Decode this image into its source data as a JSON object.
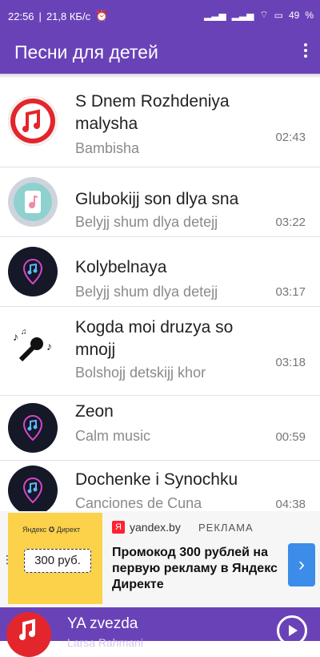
{
  "status": {
    "time": "22:56",
    "speed": "21,8 КБ/с",
    "battery": "49"
  },
  "appbar": {
    "title": "Песни для детей",
    "menu_icon": "more-vert-icon"
  },
  "songs": [
    {
      "title": "S Dnem Rozhdeniya malysha",
      "artist": "Bambisha",
      "duration": "02:43",
      "icon": "red-note-icon",
      "color": "#e3262b"
    },
    {
      "title": "Glubokijj son dlya sna",
      "artist": "Belyjj shum dlya detejj",
      "duration": "03:22",
      "icon": "teal-music-icon",
      "color": "#8fd1cf"
    },
    {
      "title": "Kolybelnaya",
      "artist": "Belyjj shum dlya detejj",
      "duration": "03:17",
      "icon": "dark-music-pin-icon",
      "color": "#141827"
    },
    {
      "title": "Kogda moi druzya so mnojj",
      "artist": "Bolshojj detskijj khor",
      "duration": "03:18",
      "icon": "microphone-notes-icon",
      "color": "#ffffff"
    },
    {
      "title": "Zeon",
      "artist": "Calm music",
      "duration": "00:59",
      "icon": "dark-music-pin-icon",
      "color": "#141827"
    },
    {
      "title": "Dochenke i Synochku",
      "artist": "Canciones de Cuna",
      "duration": "04:38",
      "icon": "dark-music-pin-icon",
      "color": "#141827"
    }
  ],
  "ad": {
    "brand": "Яндекс ✪ Директ",
    "price": "300 руб.",
    "ya": "Я",
    "domain": "yandex.by",
    "label": "РЕКЛАМА",
    "text": "Промокод 300 рублей на первую рекламу в Яндекс Директе",
    "arrow": "›"
  },
  "player": {
    "title": "YA zvezda",
    "subtitle": "Larsa Rahmani"
  }
}
